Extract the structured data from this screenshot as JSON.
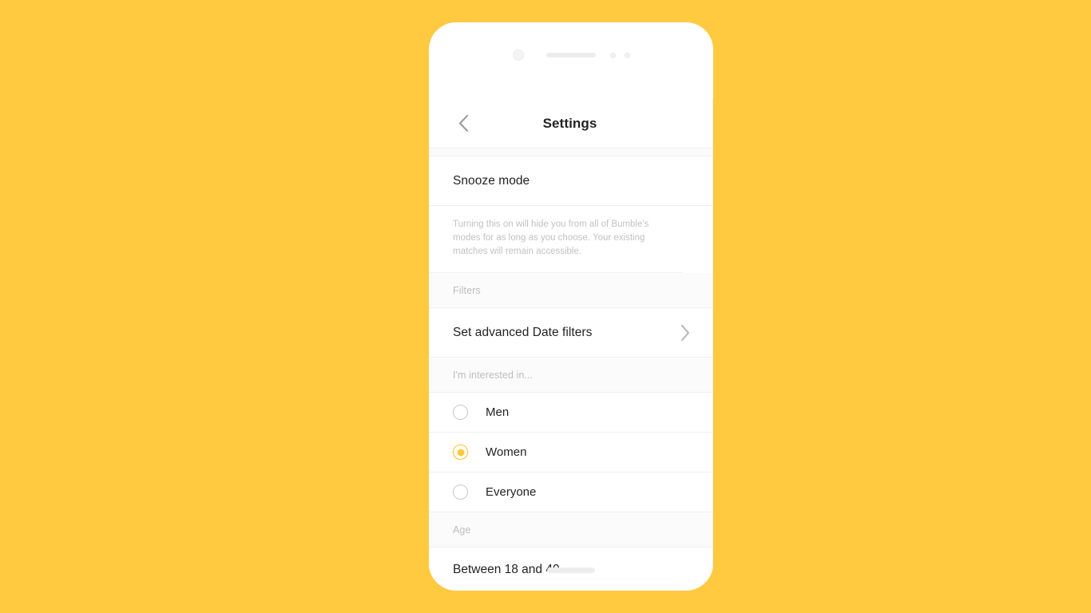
{
  "theme": {
    "background": "#FFC940",
    "accent": "#FFC83C",
    "phone_body": "#FFFFFF",
    "text_primary": "#232323",
    "text_muted": "#BDBDBD",
    "divider": "#F0F0F0"
  },
  "phone": {
    "hardware": {
      "camera": "camera-lens",
      "speaker": "earpiece-speaker",
      "sensor_1": "proximity-sensor",
      "sensor_2": "light-sensor",
      "home_indicator": "home-indicator"
    }
  },
  "app": {
    "header": {
      "title": "Settings",
      "back_icon": "chevron-left-icon"
    },
    "snooze": {
      "label": "Snooze mode",
      "description": "Turning this on will hide you from all of Bumble's modes for as long as you choose. Your existing matches will remain accessible."
    },
    "filters": {
      "section_title": "Filters",
      "row_label": "Set advanced Date filters",
      "chevron_icon": "chevron-right-icon"
    },
    "interested_in": {
      "section_title": "I'm interested in...",
      "options": [
        {
          "label": "Men",
          "selected": false
        },
        {
          "label": "Women",
          "selected": true
        },
        {
          "label": "Everyone",
          "selected": false
        }
      ]
    },
    "age": {
      "section_title": "Age",
      "range_label": "Between 18 and 40",
      "min": 18,
      "max": 40
    }
  }
}
